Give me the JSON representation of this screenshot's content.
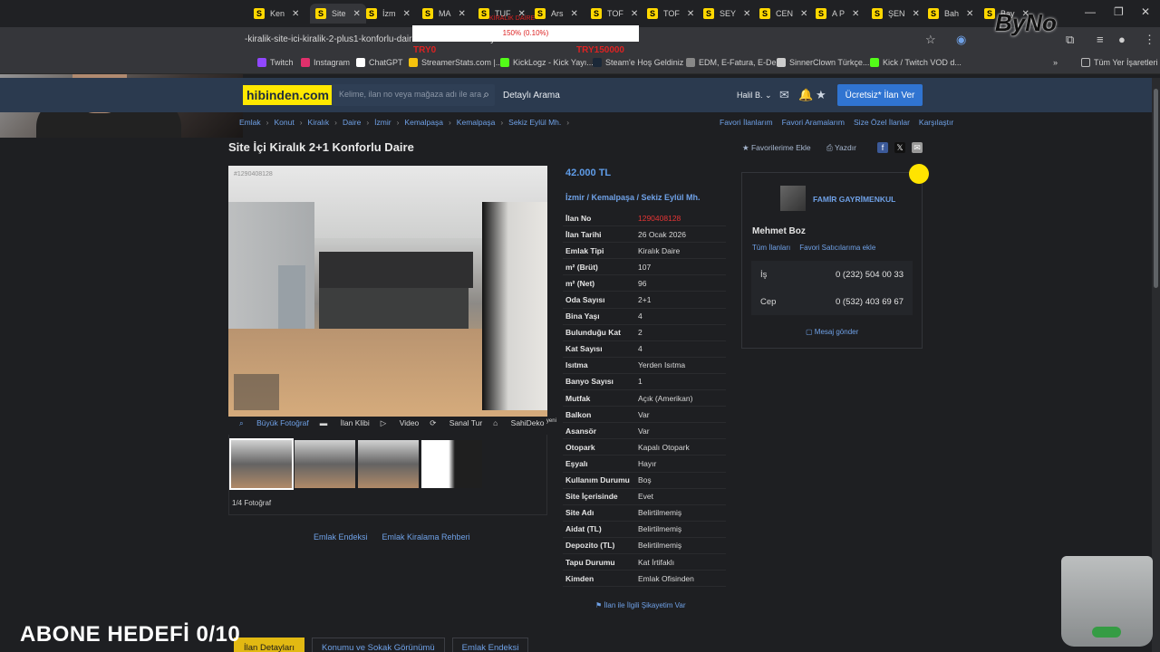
{
  "browser": {
    "tabs": [
      {
        "label": "Ken",
        "active": false
      },
      {
        "label": "Site",
        "active": true
      },
      {
        "label": "İzm",
        "active": false
      },
      {
        "label": "MA",
        "active": false
      },
      {
        "label": "TUF",
        "active": false
      },
      {
        "label": "Ars",
        "active": false
      },
      {
        "label": "TOF",
        "active": false
      },
      {
        "label": "TOF",
        "active": false
      },
      {
        "label": "SEY",
        "active": false
      },
      {
        "label": "CEN",
        "active": false
      },
      {
        "label": "A P",
        "active": false
      },
      {
        "label": "ŞEN",
        "active": false
      },
      {
        "label": "Bah",
        "active": false
      },
      {
        "label": "Bay",
        "active": false
      }
    ],
    "url": "-kiralik-site-ici-kiralik-2-plus1-konforlu-daire-1290408128/detay",
    "bookmarks": [
      "Twitch",
      "Instagram",
      "ChatGPT",
      "StreamerStats.com |...",
      "KickLogz - Kick Yayı...",
      "Steam'e Hoş Geldiniz",
      "EDM, E-Fatura, E-De...",
      "SinnerClown Türkçe...",
      "Kick / Twitch VOD d..."
    ],
    "all_bookmarks": "Tüm Yer İşaretleri",
    "bookmark_colors": [
      "#9147ff",
      "#e1306c",
      "#ffffff",
      "#f4c20d",
      "#53fc18",
      "#1b2838",
      "#888888",
      "#cccccc",
      "#53fc18"
    ]
  },
  "header": {
    "logo": "hibinden.com",
    "search_placeholder": "Kelime, ilan no veya mağaza adı ile ara",
    "detailed_search": "Detaylı Arama",
    "user": "Halil B.",
    "cta": "Ücretsiz* İlan Ver"
  },
  "breadcrumb": [
    "Emlak",
    "Konut",
    "Kiralık",
    "Daire",
    "İzmir",
    "Kemalpaşa",
    "Kemalpaşa",
    "Sekiz Eylül Mh."
  ],
  "top_links": [
    "Favori İlanlarım",
    "Favori Aramalarım",
    "Size Özel İlanlar",
    "Karşılaştır"
  ],
  "listing": {
    "title": "Site İçi Kiralık 2+1 Konforlu Daire",
    "add_fav": "Favorilerime Ekle",
    "print": "Yazdır",
    "price": "42.000 TL",
    "location": "İzmir  /  Kemalpaşa  /  Sekiz Eylül Mh.",
    "photo_code": "#1290408128",
    "media_tabs": [
      "Büyük Fotoğraf",
      "İlan Klibi",
      "Video",
      "Sanal Tur",
      "SahiDeko"
    ],
    "new_badge": "yeni",
    "photo_count": "1/4 Fotoğraf",
    "below_links": [
      "Emlak Endeksi",
      "Emlak Kiralama Rehberi"
    ],
    "details": [
      {
        "k": "İlan No",
        "v": "1290408128"
      },
      {
        "k": "İlan Tarihi",
        "v": "26 Ocak 2026"
      },
      {
        "k": "Emlak Tipi",
        "v": "Kiralık Daire"
      },
      {
        "k": "m² (Brüt)",
        "v": "107"
      },
      {
        "k": "m² (Net)",
        "v": "96"
      },
      {
        "k": "Oda Sayısı",
        "v": "2+1"
      },
      {
        "k": "Bina Yaşı",
        "v": "4"
      },
      {
        "k": "Bulunduğu Kat",
        "v": "2"
      },
      {
        "k": "Kat Sayısı",
        "v": "4"
      },
      {
        "k": "Isıtma",
        "v": "Yerden Isıtma"
      },
      {
        "k": "Banyo Sayısı",
        "v": "1"
      },
      {
        "k": "Mutfak",
        "v": "Açık (Amerikan)"
      },
      {
        "k": "Balkon",
        "v": "Var"
      },
      {
        "k": "Asansör",
        "v": "Var"
      },
      {
        "k": "Otopark",
        "v": "Kapalı Otopark"
      },
      {
        "k": "Eşyalı",
        "v": "Hayır"
      },
      {
        "k": "Kullanım Durumu",
        "v": "Boş"
      },
      {
        "k": "Site İçerisinde",
        "v": "Evet"
      },
      {
        "k": "Site Adı",
        "v": "Belirtilmemiş"
      },
      {
        "k": "Aidat (TL)",
        "v": "Belirtilmemiş"
      },
      {
        "k": "Depozito (TL)",
        "v": "Belirtilmemiş"
      },
      {
        "k": "Tapu Durumu",
        "v": "Kat İrtifaklı"
      },
      {
        "k": "Kimden",
        "v": "Emlak Ofisinden"
      }
    ],
    "complaint": "İlan ile İlgili Şikayetim Var"
  },
  "seller": {
    "firm": "FAMİR GAYRİMENKUL",
    "name": "Mehmet Boz",
    "links": [
      "Tüm İlanları",
      "Favori Satıcılarıma ekle"
    ],
    "phones": [
      {
        "label": "İş",
        "number": "0 (232) 504 00 33"
      },
      {
        "label": "Cep",
        "number": "0 (532) 403 69 67"
      }
    ],
    "message": "Mesaj gönder"
  },
  "bottom_tabs": [
    "İlan Detayları",
    "Konumu ve Sokak Görünümü",
    "Emlak Endeksi"
  ],
  "overlay": {
    "goal": "ABONE HEDEFİ 0/10",
    "donation_top": "KİRALIK DAİRE",
    "donation": "150% (0.10%)",
    "donation_left": "TRY0",
    "donation_right": "TRY150000",
    "brand": "ByNo"
  }
}
